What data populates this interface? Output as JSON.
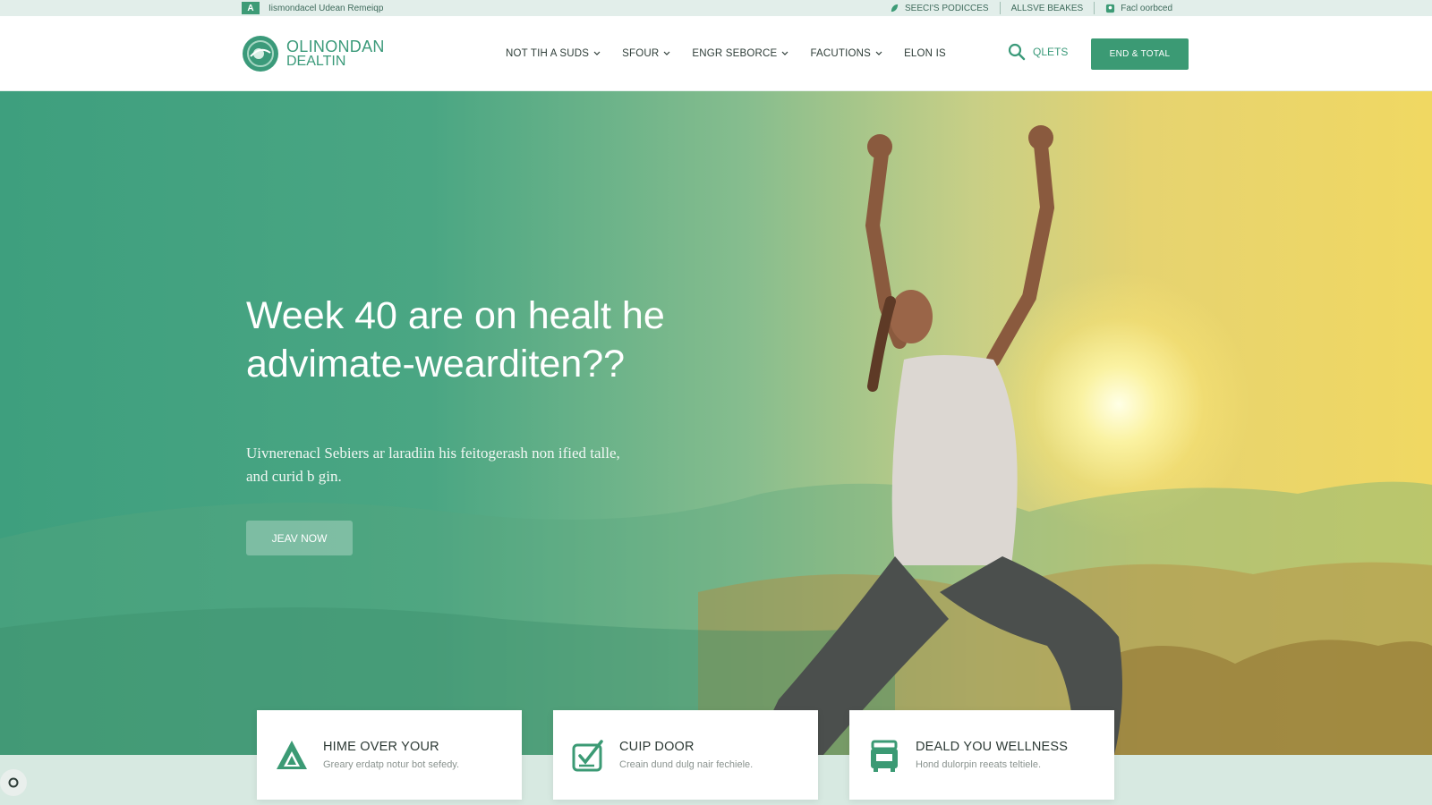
{
  "topbar": {
    "left_mark": "A",
    "left_text": "Iismondacel Udean Remeiqp",
    "items": [
      {
        "label": "SEECI'S PODICCES",
        "icon": "leaf-icon"
      },
      {
        "label": "ALLSVE BEAKES",
        "icon": ""
      },
      {
        "label": "Facl oorbced",
        "icon": "user-icon"
      }
    ]
  },
  "header": {
    "logo_line1": "OLINONDAN",
    "logo_line2": "DEALTIN",
    "nav": [
      {
        "label": "NOT TIH A SUDS",
        "dropdown": true
      },
      {
        "label": "SFOUR",
        "dropdown": true
      },
      {
        "label": "ENGR SEBORCE",
        "dropdown": true
      },
      {
        "label": "FACUTIONS",
        "dropdown": true
      },
      {
        "label": "ELON IS",
        "dropdown": false
      }
    ],
    "search_label": "QLETS",
    "cta_label": "END & TOTAL"
  },
  "hero": {
    "title": "Week 40 are on healt he advimate-wearditen??",
    "subtitle": "Uivnerenacl Sebiers ar laradiin his feitogerash non ified talle, and curid b gin.",
    "button_label": "JEAV NOW"
  },
  "cards": [
    {
      "title": "HIME OVER YOUR",
      "desc": "Greary erdatp notur bot sefedy.",
      "icon": "triangle-logo-icon"
    },
    {
      "title": "CUIP DOOR",
      "desc": "Creain dund dulg nair fechiele.",
      "icon": "clipboard-check-icon"
    },
    {
      "title": "DEALD YOU WELLNESS",
      "desc": "Hond dulorpin reeats teltiele.",
      "icon": "bag-icon"
    }
  ],
  "colors": {
    "brand_green": "#3b9a74",
    "hero_left": "#3e9f7e",
    "hero_right": "#f0d862",
    "band": "#d7e9e1"
  }
}
